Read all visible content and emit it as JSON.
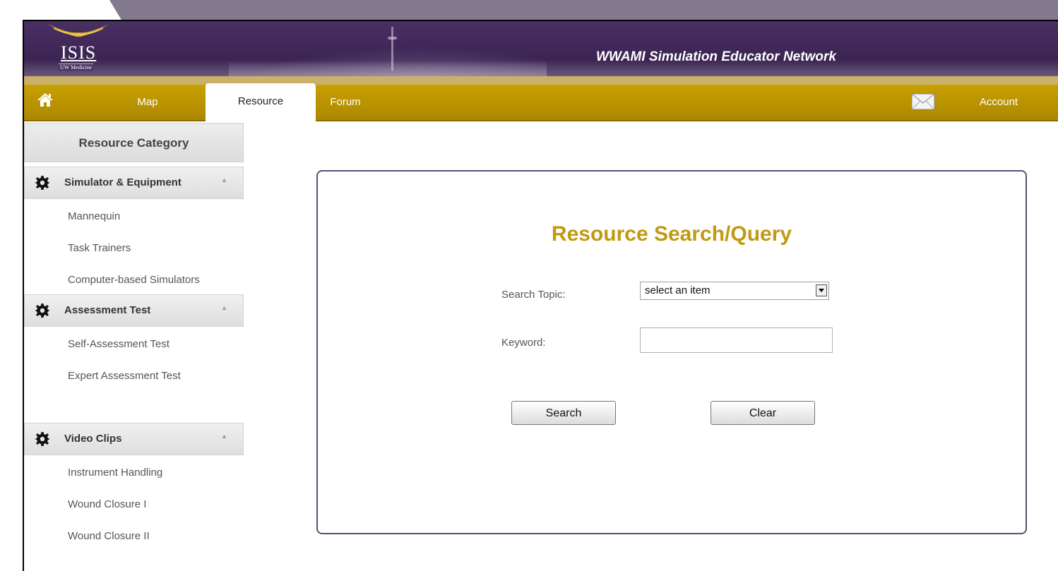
{
  "header": {
    "logo_text": "ISIS",
    "logo_sub": "UW Medicine",
    "site_title": "WWAMI Simulation Educator Network"
  },
  "nav": {
    "home_icon": "home-icon",
    "items": [
      {
        "label": "Map"
      },
      {
        "label": "Resource",
        "active": true
      },
      {
        "label": "Forum"
      }
    ],
    "mail_icon": "envelope-icon",
    "account_label": "Account"
  },
  "sidebar": {
    "title": "Resource Category",
    "groups": [
      {
        "label": "Simulator & Equipment",
        "icon": "gear-icon",
        "items": [
          "Mannequin",
          "Task Trainers",
          "Computer-based Simulators"
        ]
      },
      {
        "label": "Assessment Test",
        "icon": "gear-icon",
        "items": [
          "Self-Assessment Test",
          "Expert Assessment Test"
        ]
      },
      {
        "label": "Video Clips",
        "icon": "gear-icon",
        "items": [
          "Instrument Handling",
          "Wound Closure I",
          "Wound Closure II"
        ]
      }
    ]
  },
  "search": {
    "title": "Resource Search/Query",
    "topic_label": "Search Topic:",
    "topic_selected": "select an item",
    "keyword_label": "Keyword:",
    "keyword_value": "",
    "search_button": "Search",
    "clear_button": "Clear"
  },
  "colors": {
    "header_purple": "#3b2452",
    "nav_gold": "#c7a000",
    "title_gold": "#c09a12",
    "panel_border": "#5e4c78"
  }
}
